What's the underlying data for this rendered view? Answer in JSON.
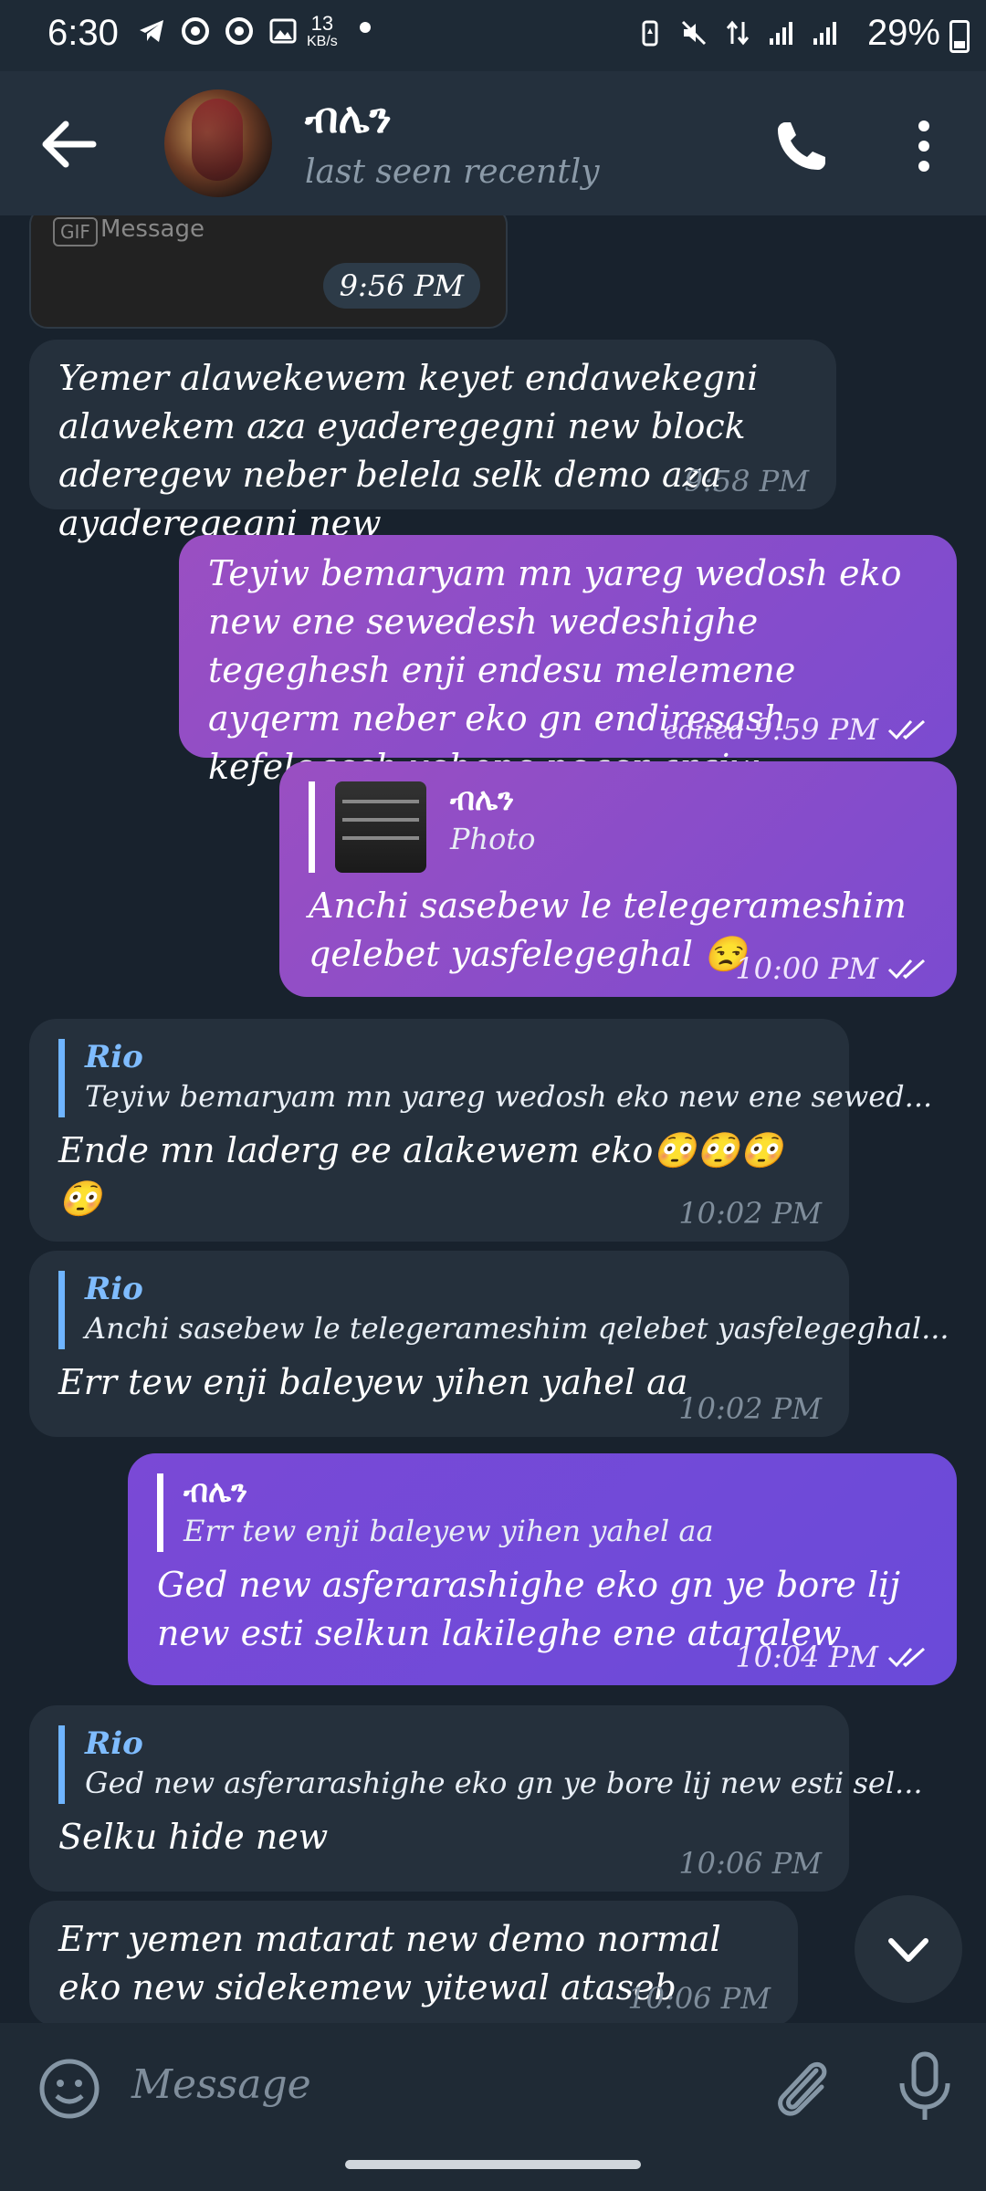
{
  "status_bar": {
    "time": "6:30",
    "net_speed": "13",
    "net_unit": "KB/s",
    "battery": "29%"
  },
  "header": {
    "title": "ብሌን",
    "subtitle": "last seen recently"
  },
  "messages": {
    "m0": {
      "time": "9:56 PM",
      "placeholder": "Message",
      "gif": "GIF"
    },
    "m1": {
      "text": "Yemer alawekewem keyet endawekegni alawekem aza eyaderegegni new block aderegew neber belela selk demo aza ayaderegegni new",
      "time": "9:58 PM"
    },
    "m2": {
      "text": "Teyiw bemaryam mn yareg wedosh eko new ene sewedesh wedeshighe tegeghesh enji endesu melemene ayqerm neber eko gn endiresash kefelegesh yehone neger argiw",
      "edited": "edited",
      "time": "9:59 PM"
    },
    "m3": {
      "reply_name": "ብሌን",
      "reply_text": "Photo",
      "text": "Anchi sasebew le telegerameshim qelebet yasfelegeghal 😒",
      "time": "10:00 PM"
    },
    "m4": {
      "reply_name": "Rio",
      "reply_text": "Teyiw bemaryam mn yareg wedosh eko new ene sewed...",
      "text": "Ende mn laderg ee alakewem eko😳😳😳😳",
      "time": "10:02 PM"
    },
    "m5": {
      "reply_name": "Rio",
      "reply_text": "Anchi sasebew le telegerameshim qelebet yasfelegeghal...",
      "text": "Err tew enji baleyew yihen yahel aa",
      "time": "10:02 PM"
    },
    "m6": {
      "reply_name": "ብሌን",
      "reply_text": "Err tew enji baleyew yihen yahel aa",
      "text": "Ged new asferarashighe eko gn ye bore lij new esti selkun lakileghe ene ataralew",
      "time": "10:04 PM"
    },
    "m7": {
      "reply_name": "Rio",
      "reply_text": "Ged new asferarashighe eko gn ye bore lij new esti sel...",
      "text": "Selku hide new",
      "time": "10:06 PM"
    },
    "m8": {
      "text": "Err yemen matarat new demo normal eko new sidekemew yitewal ataseb",
      "time": "10:06 PM"
    }
  },
  "input": {
    "placeholder": "Message"
  },
  "colors": {
    "background": "#18222d",
    "incoming": "#25303c",
    "outgoing": "#8e4fc6",
    "accent": "#6fb4ff"
  }
}
